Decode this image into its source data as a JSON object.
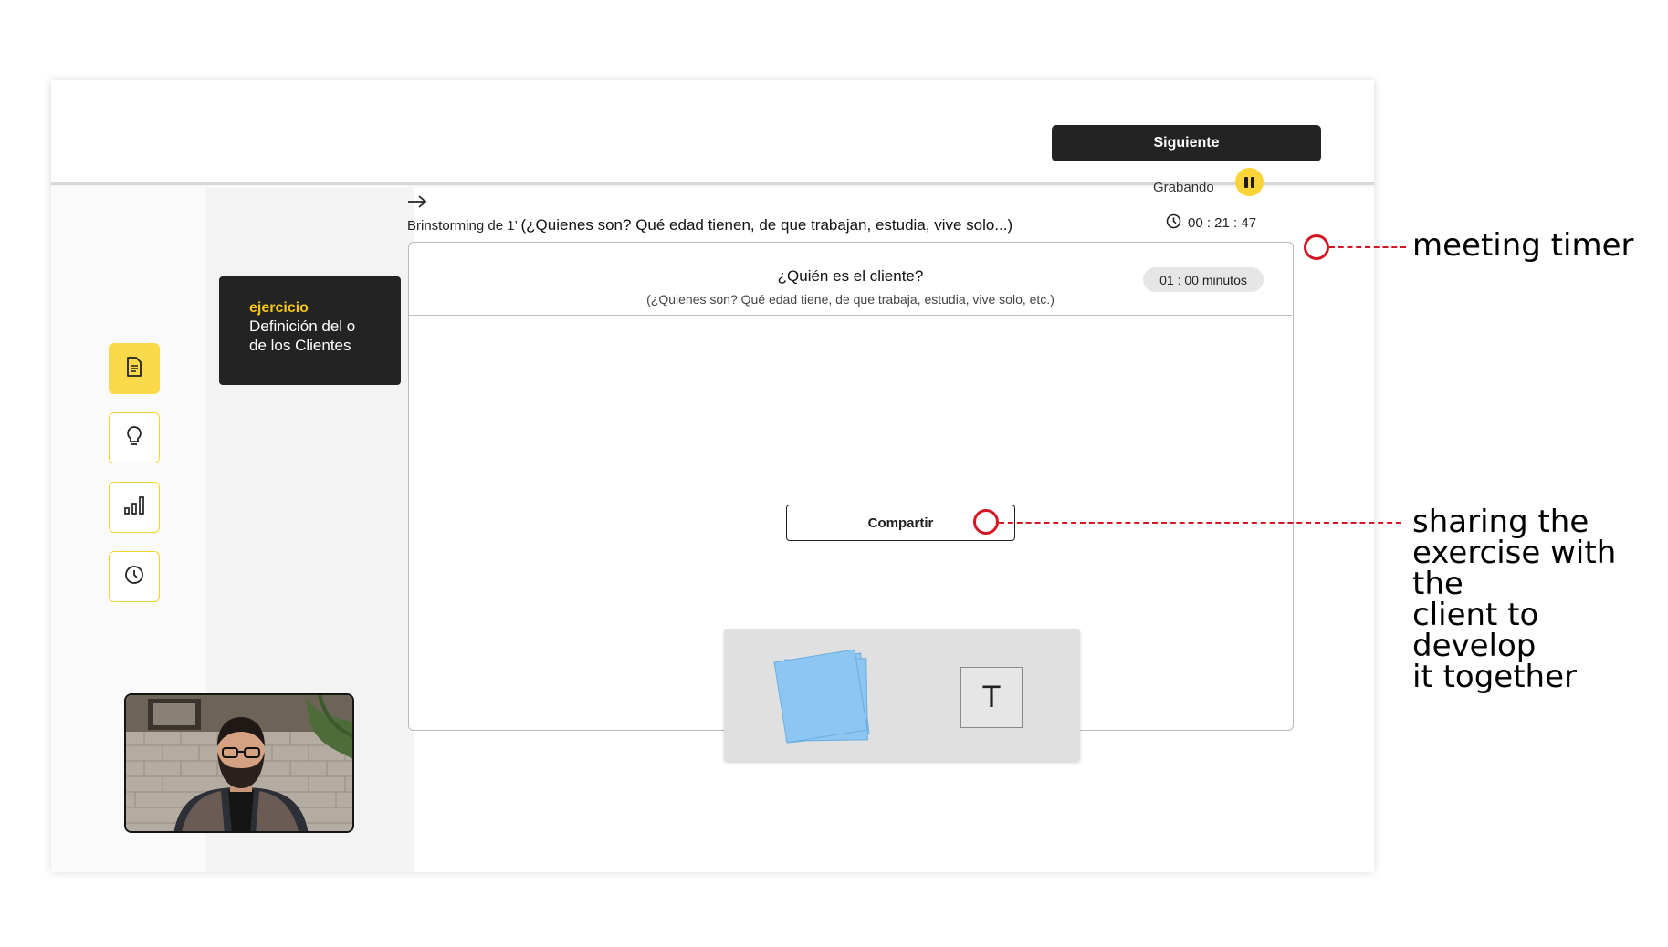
{
  "header": {
    "next_label": "Siguiente"
  },
  "sidebar": {
    "items": [
      {
        "icon": "document-icon",
        "active": true
      },
      {
        "icon": "lightbulb-icon",
        "active": false
      },
      {
        "icon": "bar-chart-icon",
        "active": false
      },
      {
        "icon": "clock-icon",
        "active": false
      }
    ]
  },
  "exercise": {
    "tag": "ejercicio",
    "title_line1": "Definición del o",
    "title_line2": "de los Clientes"
  },
  "recording": {
    "label": "Grabando",
    "timer": "00 : 21 : 47"
  },
  "brainstorm": {
    "prefix": "Brinstorming de 1’",
    "question": "(¿Quienes son? Qué edad tienen, de que trabajan, estudia, vive solo...)"
  },
  "board": {
    "title": "¿Quién es el cliente?",
    "subtitle": "(¿Quienes son? Qué edad tiene, de que trabaja, estudia, vive solo, etc.)",
    "duration": "01 : 00 minutos",
    "share_label": "Compartir",
    "text_tool": "T"
  },
  "annotations": {
    "timer_note": "meeting timer",
    "share_note_lines": [
      "sharing the",
      "exercise with the",
      "client to develop",
      "it together"
    ]
  },
  "colors": {
    "accent_yellow": "#fbd94a",
    "annotation_red": "#d31524",
    "dark": "#232323",
    "sticky_blue": "#8dc6f2"
  }
}
